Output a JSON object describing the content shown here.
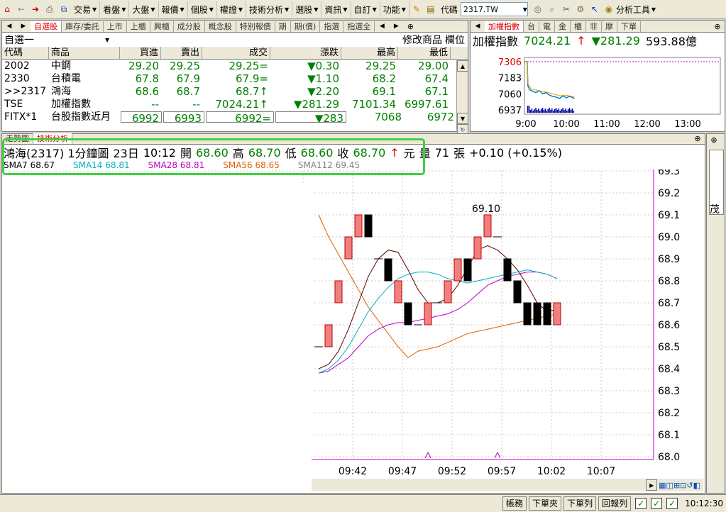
{
  "toolbar": {
    "menus": [
      "交易",
      "看盤",
      "大盤",
      "報價",
      "個股",
      "權證",
      "技術分析",
      "選股",
      "資訊",
      "自訂",
      "功能"
    ],
    "code_label": "代碼",
    "code_value": "2317.TW",
    "analysis_tools": "分析工具"
  },
  "watchlist": {
    "tabs": [
      "自選股",
      "庫存/委託",
      "上市",
      "上櫃",
      "興櫃",
      "成分股",
      "概念股",
      "特別報價",
      "期",
      "期(價)",
      "指選",
      "指選全"
    ],
    "list_name": "自選一",
    "modify_label": "修改商品",
    "fields_label": "欄位",
    "columns": [
      "代碼",
      "商品",
      "買進",
      "賣出",
      "成交",
      "漲跌",
      "最高",
      "最低"
    ],
    "rows": [
      {
        "code": "2002",
        "name": "中鋼",
        "bid": "29.20",
        "ask": "29.25",
        "last": "29.25=",
        "change": "▼0.30",
        "high": "29.25",
        "low": "29.00"
      },
      {
        "code": "2330",
        "name": "台積電",
        "bid": "67.8",
        "ask": "67.9",
        "last": "67.9=",
        "change": "▼1.10",
        "high": "68.2",
        "low": "67.4"
      },
      {
        "code": ">>2317",
        "name": "鴻海",
        "bid": "68.6",
        "ask": "68.7",
        "last": "68.7↑",
        "change": "▼2.20",
        "high": "69.1",
        "low": "67.1"
      },
      {
        "code": "TSE",
        "name": "加權指數",
        "bid": "--",
        "ask": "--",
        "last": "7024.21↑",
        "change": "▼281.29",
        "high": "7101.34",
        "low": "6997.61"
      },
      {
        "code": "FITX*1",
        "name": "台股指數近月",
        "bid": "6992",
        "ask": "6993",
        "last": "6992=",
        "change": "▼283",
        "high": "7068",
        "low": "6972"
      }
    ]
  },
  "index_panel": {
    "tabs": [
      "加權指數",
      "台",
      "電",
      "金",
      "櫃",
      "非",
      "摩",
      "下單"
    ],
    "name": "加權指數",
    "value": "7024.21",
    "change": "▼281.29",
    "volume": "593.88億",
    "y_labels": [
      "7306",
      "7183",
      "7060",
      "6937"
    ],
    "x_labels": [
      "9:00",
      "10:00",
      "11:00",
      "12:00",
      "13:00"
    ]
  },
  "chart_tabs": [
    "走勢圖",
    "技術分析"
  ],
  "quote": {
    "title": "鴻海(2317) 1分鐘圖",
    "date": "23日",
    "time": "10:12",
    "open_label": "開",
    "open": "68.60",
    "high_label": "高",
    "high": "68.70",
    "low_label": "低",
    "low": "68.60",
    "close_label": "收",
    "close": "68.70",
    "unit": "元",
    "vol_label": "量",
    "vol": "71",
    "vol_unit": "張",
    "chg": "+0.10 (+0.15%)"
  },
  "sma": [
    {
      "label": "SMA7 68.67",
      "color": "#000000"
    },
    {
      "label": "SMA14 68.81",
      "color": "#00b0c0"
    },
    {
      "label": "SMA28 68.81",
      "color": "#c000c0"
    },
    {
      "label": "SMA56 68.65",
      "color": "#e06000"
    },
    {
      "label": "SMA112 69.45",
      "color": "#808080"
    }
  ],
  "chart_data": {
    "type": "candlestick",
    "y_ticks": [
      "69.3",
      "69.2",
      "69.1",
      "69.0",
      "68.9",
      "68.8",
      "68.7",
      "68.6",
      "68.5",
      "68.4",
      "68.3",
      "68.2",
      "68.1",
      "68.0"
    ],
    "ylim": [
      68.0,
      69.3
    ],
    "x_ticks": [
      ":37",
      "09:42",
      "09:47",
      "09:52",
      "09:57",
      "10:02",
      "10:07"
    ],
    "annotation": "69.10",
    "candles": [
      {
        "o": 68.5,
        "h": 68.5,
        "l": 68.5,
        "c": 68.5
      },
      {
        "o": 68.5,
        "h": 68.6,
        "l": 68.5,
        "c": 68.6
      },
      {
        "o": 68.7,
        "h": 68.8,
        "l": 68.7,
        "c": 68.8
      },
      {
        "o": 68.9,
        "h": 69.0,
        "l": 68.9,
        "c": 69.0
      },
      {
        "o": 69.0,
        "h": 69.1,
        "l": 69.0,
        "c": 69.1
      },
      {
        "o": 69.1,
        "h": 69.1,
        "l": 69.0,
        "c": 69.0
      },
      {
        "o": 68.9,
        "h": 68.9,
        "l": 68.9,
        "c": 68.9
      },
      {
        "o": 68.9,
        "h": 68.9,
        "l": 68.8,
        "c": 68.8
      },
      {
        "o": 68.7,
        "h": 68.8,
        "l": 68.7,
        "c": 68.8
      },
      {
        "o": 68.7,
        "h": 68.7,
        "l": 68.6,
        "c": 68.6
      },
      {
        "o": 68.6,
        "h": 68.6,
        "l": 68.6,
        "c": 68.6
      },
      {
        "o": 68.6,
        "h": 68.7,
        "l": 68.6,
        "c": 68.7
      },
      {
        "o": 68.7,
        "h": 68.7,
        "l": 68.7,
        "c": 68.7
      },
      {
        "o": 68.7,
        "h": 68.8,
        "l": 68.7,
        "c": 68.8
      },
      {
        "o": 68.8,
        "h": 68.9,
        "l": 68.8,
        "c": 68.9
      },
      {
        "o": 68.9,
        "h": 68.9,
        "l": 68.8,
        "c": 68.8
      },
      {
        "o": 68.9,
        "h": 69.0,
        "l": 68.9,
        "c": 69.0
      },
      {
        "o": 69.0,
        "h": 69.1,
        "l": 69.0,
        "c": 69.1
      },
      {
        "o": 69.0,
        "h": 69.0,
        "l": 69.0,
        "c": 69.0
      },
      {
        "o": 68.9,
        "h": 68.9,
        "l": 68.8,
        "c": 68.8
      },
      {
        "o": 68.8,
        "h": 68.8,
        "l": 68.7,
        "c": 68.7
      },
      {
        "o": 68.7,
        "h": 68.7,
        "l": 68.6,
        "c": 68.6
      },
      {
        "o": 68.7,
        "h": 68.7,
        "l": 68.6,
        "c": 68.6
      },
      {
        "o": 68.7,
        "h": 68.7,
        "l": 68.6,
        "c": 68.6
      },
      {
        "o": 68.6,
        "h": 68.7,
        "l": 68.6,
        "c": 68.7
      }
    ],
    "sma7": [
      68.4,
      68.42,
      68.48,
      68.58,
      68.7,
      68.82,
      68.9,
      68.94,
      68.93,
      68.85,
      68.76,
      68.7,
      68.7,
      68.72,
      68.78,
      68.86,
      68.94,
      68.96,
      68.94,
      68.9,
      68.85,
      68.78,
      68.7,
      68.66,
      68.67
    ],
    "sma14": [
      68.38,
      68.4,
      68.44,
      68.5,
      68.58,
      68.66,
      68.72,
      68.77,
      68.81,
      68.83,
      68.84,
      68.84,
      68.83,
      68.81,
      68.8,
      68.79,
      68.8,
      68.81,
      68.82,
      68.83,
      68.84,
      68.85,
      68.84,
      68.83,
      68.81
    ],
    "sma28": [
      68.38,
      68.39,
      68.42,
      68.45,
      68.5,
      68.55,
      68.58,
      68.6,
      68.61,
      68.61,
      68.62,
      68.63,
      68.64,
      68.65,
      68.67,
      68.7,
      68.74,
      68.78,
      68.8,
      68.82,
      68.83,
      68.84,
      68.84,
      68.83,
      68.81
    ],
    "sma56": [
      69.1,
      69.0,
      68.92,
      68.84,
      68.76,
      68.68,
      68.62,
      68.56,
      68.5,
      68.45,
      68.48,
      68.49,
      68.5,
      68.52,
      68.54,
      68.56,
      68.57,
      68.58,
      68.59,
      68.6,
      68.61,
      68.62,
      68.63,
      68.64,
      68.65
    ]
  },
  "status": {
    "buttons": [
      "帳務",
      "下單夾",
      "下單列",
      "回報列"
    ],
    "time": "10:12:30"
  }
}
